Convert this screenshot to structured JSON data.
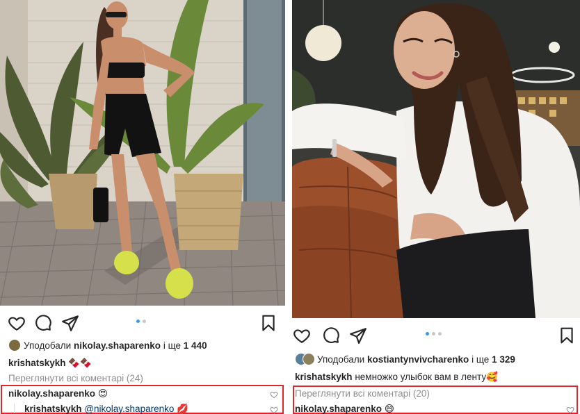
{
  "left_post": {
    "likes": {
      "prefix": "Уподобали",
      "user": "nikolay.shaparenko",
      "middle": "і ще",
      "count": "1 440"
    },
    "caption": {
      "user": "krishatskykh",
      "text": "🍫🍫"
    },
    "view_comments": "Переглянути всі коментарі (24)",
    "comments": [
      {
        "user": "nikolay.shaparenko",
        "text": "😍"
      },
      {
        "user": "krishatskykh",
        "mention": "@nikolay.shaparenko",
        "text": "💋"
      }
    ]
  },
  "right_post": {
    "likes": {
      "prefix": "Уподобали",
      "user": "kostiantynvivcharenko",
      "middle": "і ще",
      "count": "1 329"
    },
    "caption": {
      "user": "krishatskykh",
      "text": "немножко улыбок вам в ленту🥰"
    },
    "view_comments": "Переглянути всі коментарі (20)",
    "comments": [
      {
        "user": "nikolay.shaparenko",
        "text": "😄"
      }
    ]
  },
  "colors": {
    "highlight": "#e0252d",
    "carousel_active": "#3897f0",
    "carousel_inactive": "#c7c7c7"
  },
  "icons": [
    "heart-icon",
    "comment-icon",
    "share-icon",
    "bookmark-icon"
  ]
}
